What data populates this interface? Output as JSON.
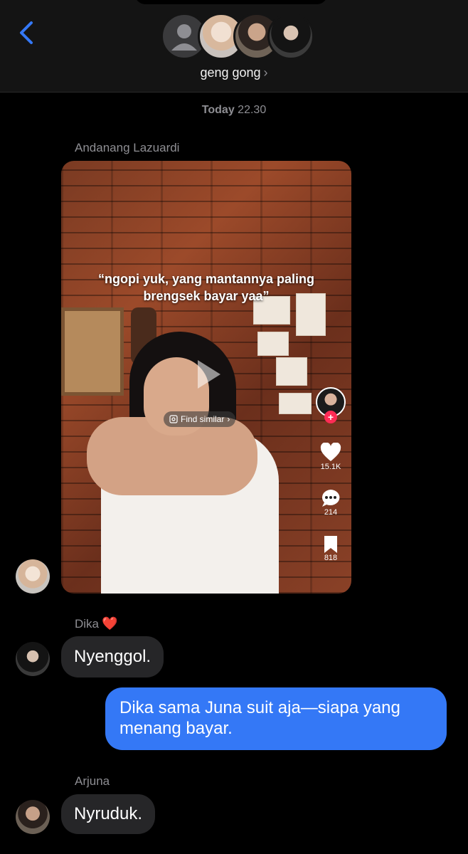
{
  "header": {
    "group_name": "geng gong",
    "chevron": "›"
  },
  "thread": {
    "timestamp_day": "Today",
    "timestamp_time": "22.30"
  },
  "messages": [
    {
      "sender": "Andanang Lazuardi",
      "type": "video",
      "video": {
        "caption_line1": "“ngopi yuk, yang mantannya paling",
        "caption_line2": "brengsek bayar yaa”",
        "find_similar": "Find similar",
        "likes": "15.1K",
        "comments": "214",
        "saves": "818"
      }
    },
    {
      "sender": "Dika",
      "sender_emoji": "❤️",
      "text": "Nyenggol."
    },
    {
      "sender": "me",
      "text_line1": "Dika sama Juna suit aja—siapa yang",
      "text_line2": "menang bayar."
    },
    {
      "sender": "Arjuna",
      "text": "Nyruduk."
    }
  ],
  "icons": [
    "back-chevron-icon",
    "person-icon",
    "play-icon",
    "find-similar-icon",
    "heart-icon",
    "comment-icon",
    "bookmark-icon",
    "plus-icon"
  ],
  "colors": {
    "accent": "#3478f6",
    "incoming_bubble": "#262628",
    "follow": "#fe2c55"
  }
}
